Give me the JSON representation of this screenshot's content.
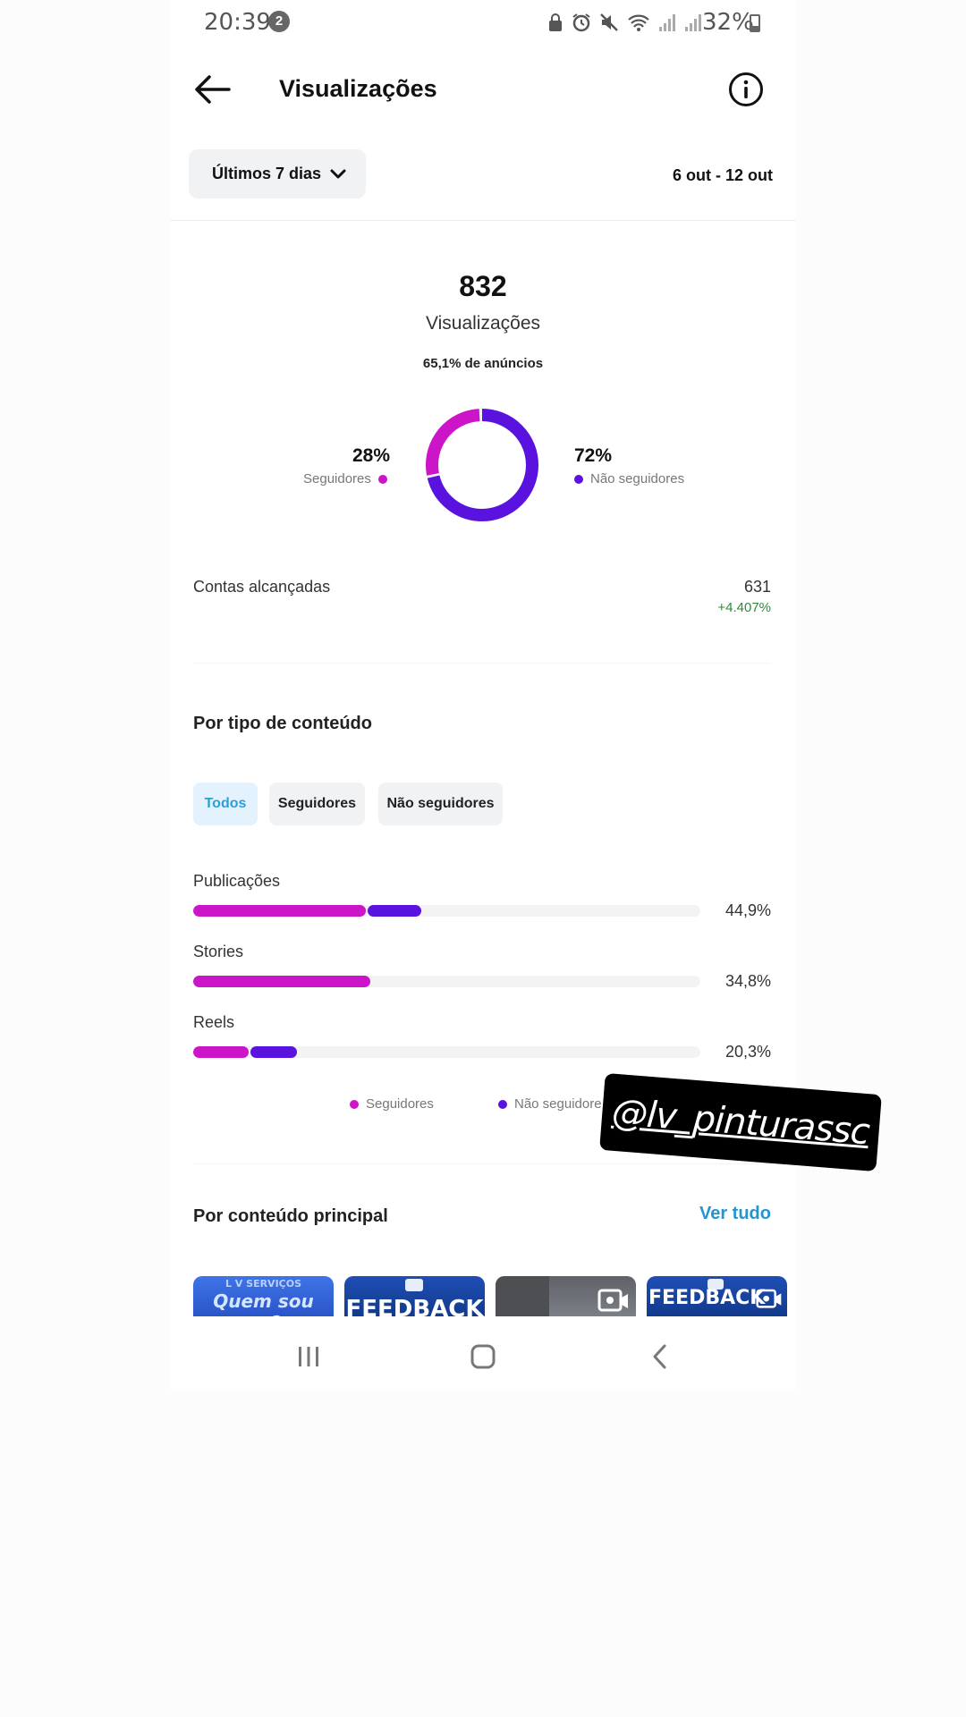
{
  "status_bar": {
    "time": "20:39",
    "notification_count": "2",
    "battery": "32%",
    "battery_level": 0.32
  },
  "header": {
    "title": "Visualizações"
  },
  "filter": {
    "range_label": "Últimos 7 dias",
    "date_range": "6 out - 12 out"
  },
  "summary": {
    "total": "832",
    "total_label": "Visualizações",
    "ads_note": "65,1% de anúncios",
    "followers_pct": "28%",
    "followers_label": "Seguidores",
    "non_followers_pct": "72%",
    "non_followers_label": "Não seguidores"
  },
  "reach": {
    "label": "Contas alcançadas",
    "value": "631",
    "change": "+4.407%"
  },
  "content_type": {
    "title": "Por tipo de conteúdo",
    "tabs": [
      "Todos",
      "Seguidores",
      "Não seguidores"
    ],
    "active_tab": "Todos"
  },
  "chart_data": {
    "type": "bar",
    "categories": [
      "Publicações",
      "Stories",
      "Reels"
    ],
    "percent_labels": [
      "44,9%",
      "34,8%",
      "20,3%"
    ],
    "values": [
      44.9,
      34.8,
      20.3
    ],
    "series": [
      {
        "name": "Seguidores",
        "values": [
          34.0,
          35.0,
          11.0
        ]
      },
      {
        "name": "Não seguidores",
        "values": [
          11.0,
          0.0,
          9.5
        ]
      }
    ],
    "donut": {
      "segments": [
        {
          "name": "Seguidores",
          "value": 28
        },
        {
          "name": "Não seguidores",
          "value": 72
        }
      ]
    },
    "legend": [
      "Seguidores",
      "Não seguidores"
    ],
    "colors": {
      "followers": "#cc14c8",
      "non_followers": "#5a12de"
    }
  },
  "bars_legend": {
    "followers": "Seguidores",
    "non_followers": "Não seguidore"
  },
  "sticker": {
    "text": "@lv_pinturassc"
  },
  "main_content": {
    "title": "Por conteúdo principal",
    "see_all": "Ver tudo",
    "thumbs": [
      "Quem sou eu?",
      "FEEDBACK",
      "",
      "FEEDBACK"
    ],
    "thumb_caption": "L V SERVIÇOS"
  },
  "colors": {
    "accent": "#2196d3",
    "positive": "#2f8a3b"
  }
}
